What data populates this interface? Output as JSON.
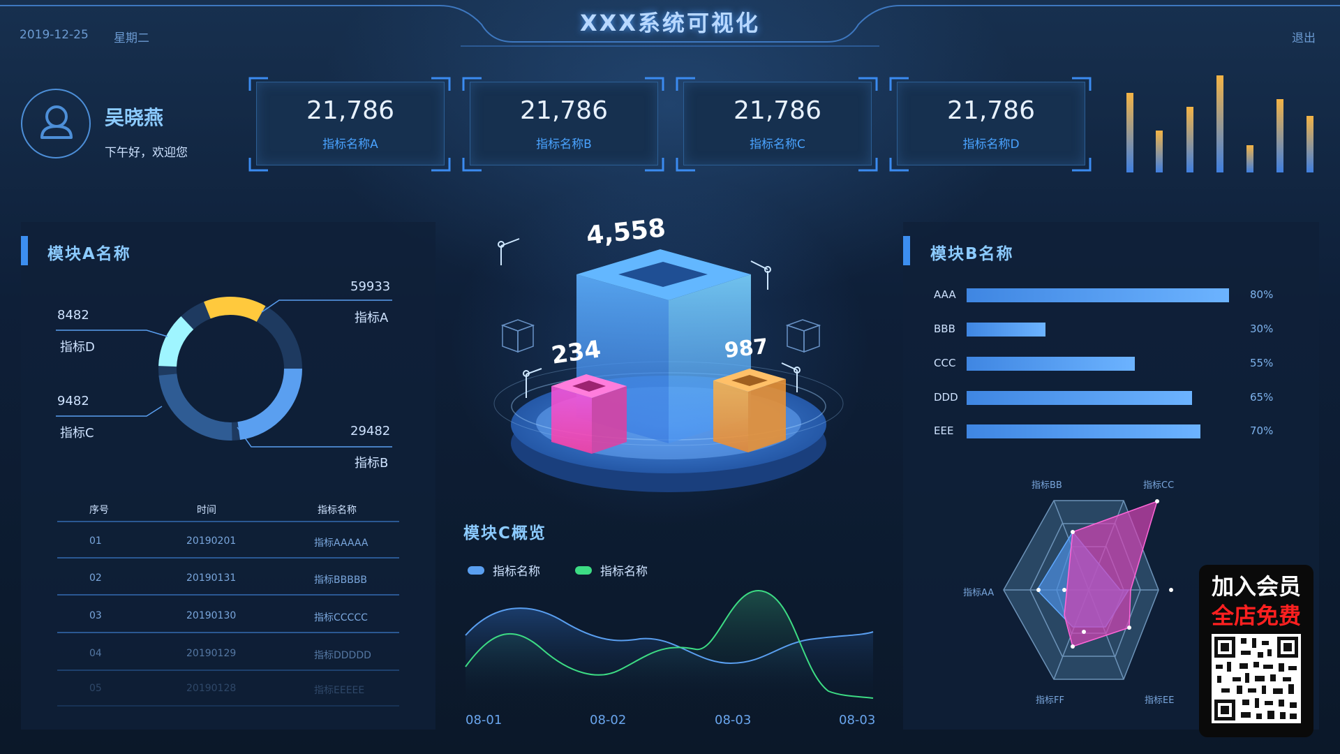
{
  "header": {
    "title": "XXX系统可视化",
    "date": "2019-12-25",
    "weekday": "星期二",
    "logout": "退出"
  },
  "user": {
    "name": "吴晓燕",
    "greeting": "下午好，欢迎您"
  },
  "kpis": [
    {
      "value": "21,786",
      "label": "指标名称A"
    },
    {
      "value": "21,786",
      "label": "指标名称B"
    },
    {
      "value": "21,786",
      "label": "指标名称C"
    },
    {
      "value": "21,786",
      "label": "指标名称D"
    }
  ],
  "module_a": {
    "title": "模块A名称",
    "donut": [
      {
        "name": "指标A",
        "value": "59933"
      },
      {
        "name": "指标B",
        "value": "29482"
      },
      {
        "name": "指标C",
        "value": "9482"
      },
      {
        "name": "指标D",
        "value": "8482"
      }
    ],
    "table": {
      "headers": [
        "序号",
        "时间",
        "指标名称"
      ],
      "rows": [
        [
          "01",
          "20190201",
          "指标AAAAA"
        ],
        [
          "02",
          "20190131",
          "指标BBBBB"
        ],
        [
          "03",
          "20190130",
          "指标CCCCC"
        ],
        [
          "04",
          "20190129",
          "指标DDDDD"
        ],
        [
          "05",
          "20190128",
          "指标EEEEE"
        ]
      ]
    }
  },
  "center_graphic": {
    "main_value": "4,558",
    "left_value": "234",
    "right_value": "987"
  },
  "module_c": {
    "title": "模块C概览",
    "legend": [
      "指标名称",
      "指标名称"
    ],
    "x_ticks": [
      "08-01",
      "08-02",
      "08-03",
      "08-03"
    ]
  },
  "module_b": {
    "title": "模块B名称",
    "bars": [
      {
        "name": "AAA",
        "percent": "80%",
        "value": 0.8
      },
      {
        "name": "BBB",
        "percent": "30%",
        "value": 0.3
      },
      {
        "name": "CCC",
        "percent": "55%",
        "value": 0.55
      },
      {
        "name": "DDD",
        "percent": "65%",
        "value": 0.65
      },
      {
        "name": "EEE",
        "percent": "70%",
        "value": 0.7
      }
    ],
    "radar_labels": [
      "指标BB",
      "指标CC",
      "指标AA",
      "指标FF",
      "指标EE"
    ]
  },
  "promo": {
    "line1": "加入会员",
    "line2": "全店免费"
  },
  "colors": {
    "accent": "#3c8ef0",
    "title_blue": "#8ccbff",
    "donut_yellow": "#ffc93d",
    "donut_cyan": "#9ff5ff",
    "line_green": "#3ddc84",
    "line_blue": "#5a9ff0",
    "radar_pink": "#d545b5",
    "promo_red": "#ff2020"
  }
}
